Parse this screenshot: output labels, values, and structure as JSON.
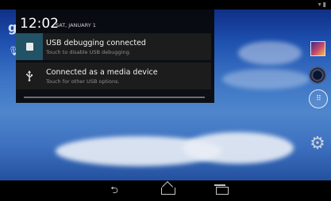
{
  "status_bar": {
    "icons": [
      "wifi-icon",
      "battery-icon"
    ]
  },
  "shade": {
    "time": "12:02",
    "date": "SAT, JANUARY 1",
    "notifications": [
      {
        "title": "USB debugging connected",
        "text": "Touch to disable USB debugging.",
        "icon": "android-icon"
      },
      {
        "title": "Connected as a media device",
        "text": "Touch for other USB options.",
        "icon": "usb-icon"
      }
    ]
  },
  "home": {
    "search_letter": "g",
    "dock_icons": [
      "gallery-icon",
      "camera-icon",
      "apps-icon",
      "settings-icon"
    ]
  },
  "nav_bar": {
    "buttons": [
      "back",
      "home",
      "recents"
    ]
  },
  "colors": {
    "shade_bg": "#080808",
    "notif_bg": "#1c1c1c",
    "debug_icon_bg": "#225266"
  }
}
